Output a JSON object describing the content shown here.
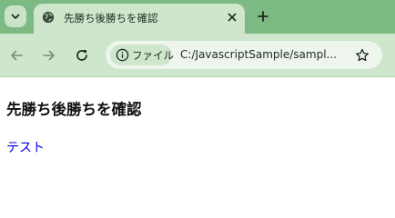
{
  "tab": {
    "title": "先勝ち後勝ちを確認"
  },
  "omnibox": {
    "security_chip_label": "ファイル",
    "url": "C:/JavascriptSample/sampl..."
  },
  "page": {
    "heading": "先勝ち後勝ちを確認",
    "link_text": "テスト"
  },
  "colors": {
    "frame": "#7dba83",
    "tab_active": "#cde6cc",
    "link": "#0000ee"
  },
  "icons": [
    "tab-search-icon",
    "globe-icon",
    "close-icon",
    "plus-icon",
    "back-arrow-icon",
    "forward-arrow-icon",
    "reload-icon",
    "info-icon",
    "star-icon"
  ]
}
